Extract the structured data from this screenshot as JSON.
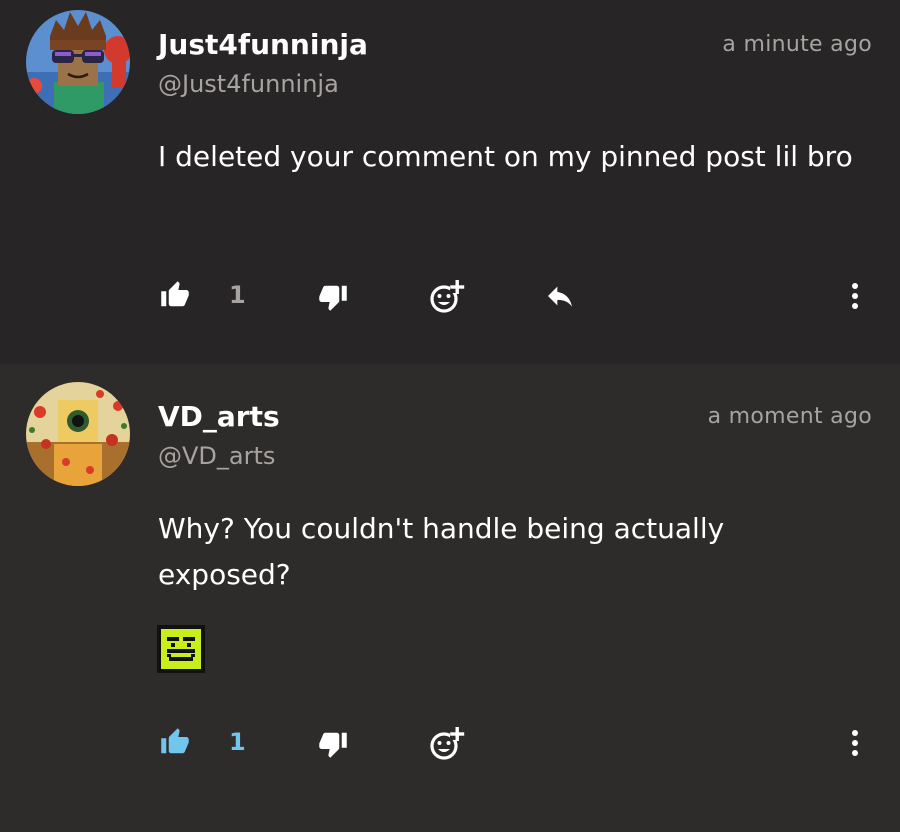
{
  "comments": [
    {
      "username": "Just4funninja",
      "handle": "@Just4funninja",
      "timestamp": "a minute ago",
      "text": "I deleted your comment on my pinned post lil bro",
      "likes": "1",
      "liked": false,
      "has_reply_button": true,
      "has_emoji": false
    },
    {
      "username": "VD_arts",
      "handle": "@VD_arts",
      "timestamp": "a moment ago",
      "text": "Why? You couldn't handle being actually exposed?",
      "likes": "1",
      "liked": true,
      "has_reply_button": false,
      "has_emoji": true,
      "emoji_icon": "smirk-robot-emoji-icon"
    }
  ],
  "colors": {
    "background": "#272525",
    "background_alt": "#2e2b2b",
    "text": "#ffffff",
    "muted_text": "#a7a3a0",
    "icon": "#ffffff",
    "liked_accent": "#70c6ec",
    "emoji_yellow": "#c8ee1c"
  },
  "icons": {
    "like": "thumbs-up-icon",
    "dislike": "thumbs-down-icon",
    "reaction": "add-reaction-icon",
    "reply": "reply-arrow-icon",
    "more": "more-vertical-icon"
  }
}
